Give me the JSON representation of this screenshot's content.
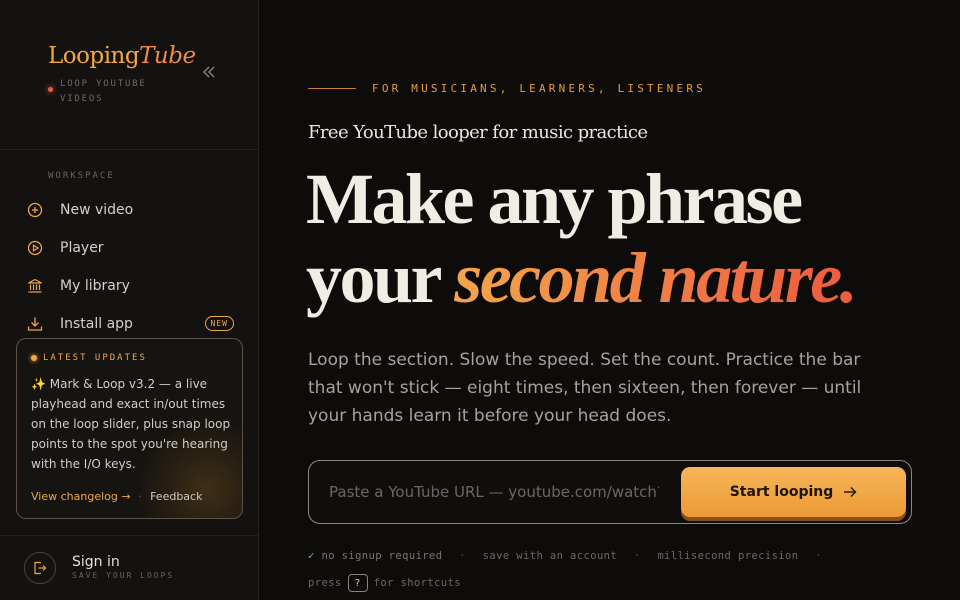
{
  "brand": {
    "logo_looping": "Looping",
    "logo_tube": "Tube",
    "tagline": "LOOP YOUTUBE VIDEOS"
  },
  "sidebar": {
    "section_label": "WORKSPACE",
    "items": [
      {
        "label": "New video",
        "icon": "plus-circle-icon"
      },
      {
        "label": "Player",
        "icon": "play-circle-icon"
      },
      {
        "label": "My library",
        "icon": "library-icon"
      },
      {
        "label": "Install app",
        "icon": "download-icon",
        "badge": "NEW"
      }
    ],
    "updates": {
      "title": "LATEST UPDATES",
      "body": "✨ Mark & Loop v3.2 — a live playhead and exact in/out times on the loop slider, plus snap loop points to the spot you're hearing with the I/O keys.",
      "changelog_link": "View changelog →",
      "separator": "·",
      "feedback_link": "Feedback"
    },
    "signin": {
      "label": "Sign in",
      "sub": "SAVE YOUR LOOPS"
    }
  },
  "hero": {
    "eyebrow": "FOR MUSICIANS, LEARNERS, LISTENERS",
    "subhead": "Free YouTube looper for music practice",
    "headline_line1": "Make any phrase",
    "headline_line2_plain": "your ",
    "headline_line2_accent": "second nature.",
    "description": "Loop the section. Slow the speed. Set the count. Practice the bar that won't stick — eight times, then sixteen, then forever — until your hands learn it before your head does."
  },
  "url_form": {
    "placeholder": "Paste a YouTube URL — youtube.com/watch?v=...",
    "value": "",
    "cta_label": "Start looping"
  },
  "meta": {
    "check": "✓",
    "no_signup": "no signup required",
    "save_account": "save with an account",
    "precision": "millisecond precision",
    "sep": "·",
    "press": "press",
    "key": "?",
    "for_shortcuts": "for shortcuts"
  },
  "colors": {
    "accent": "#f0a748",
    "accent_red": "#ee5a3e",
    "background": "#0d0c0b",
    "sidebar": "#131211"
  }
}
